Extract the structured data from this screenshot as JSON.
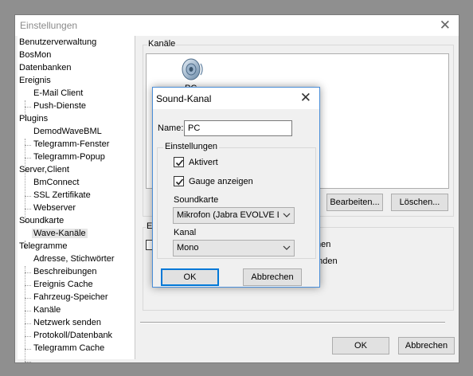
{
  "main_window": {
    "title": "Einstellungen"
  },
  "tree": {
    "items": [
      {
        "label": "Benutzerverwaltung"
      },
      {
        "label": "BosMon"
      },
      {
        "label": "Datenbanken"
      },
      {
        "label": "Ereignis"
      },
      {
        "label": "E-Mail Client"
      },
      {
        "label": "Push-Dienste"
      },
      {
        "label": "Plugins"
      },
      {
        "label": "DemodWaveBML"
      },
      {
        "label": "Telegramm-Fenster"
      },
      {
        "label": "Telegramm-Popup"
      },
      {
        "label": "Server,Client"
      },
      {
        "label": "BmConnect"
      },
      {
        "label": "SSL Zertifikate"
      },
      {
        "label": "Webserver"
      },
      {
        "label": "Soundkarte"
      },
      {
        "label": "Wave-Kanäle"
      },
      {
        "label": "Telegramme"
      },
      {
        "label": "Adresse, Stichwörter"
      },
      {
        "label": "Beschreibungen"
      },
      {
        "label": "Ereignis Cache"
      },
      {
        "label": "Fahrzeug-Speicher"
      },
      {
        "label": "Kanäle"
      },
      {
        "label": "Netzwerk senden"
      },
      {
        "label": "Protokoll/Datenbank"
      },
      {
        "label": "Telegramm Cache"
      }
    ]
  },
  "channels_panel": {
    "group_label": "Kanäle",
    "items": [
      {
        "label": "PC",
        "icon": "speaker-icon"
      }
    ],
    "edit_button": "Bearbeiten...",
    "delete_button": "Löschen..."
  },
  "behind_section": {
    "label_fragment": "E",
    "option1_fragment": "fnen",
    "option2_fragment": "unden"
  },
  "footer": {
    "ok_button": "OK",
    "cancel_button": "Abbrechen"
  },
  "dialog": {
    "title": "Sound-Kanal",
    "name_label": "Name:",
    "name_value": "PC",
    "settings_group": "Einstellungen",
    "checkbox_active": {
      "label": "Aktivert",
      "checked": true
    },
    "checkbox_gauge": {
      "label": "Gauge anzeigen",
      "checked": true
    },
    "soundcard_label": "Soundkarte",
    "soundcard_value": "Mikrofon (Jabra EVOLVE LI",
    "channel_label": "Kanal",
    "channel_value": "Mono",
    "ok_button": "OK",
    "cancel_button": "Abbrechen"
  },
  "colors": {
    "focus_border": "#0078d7",
    "dialog_border": "#4a8ed8",
    "selection_bg": "#e5e5e5"
  }
}
